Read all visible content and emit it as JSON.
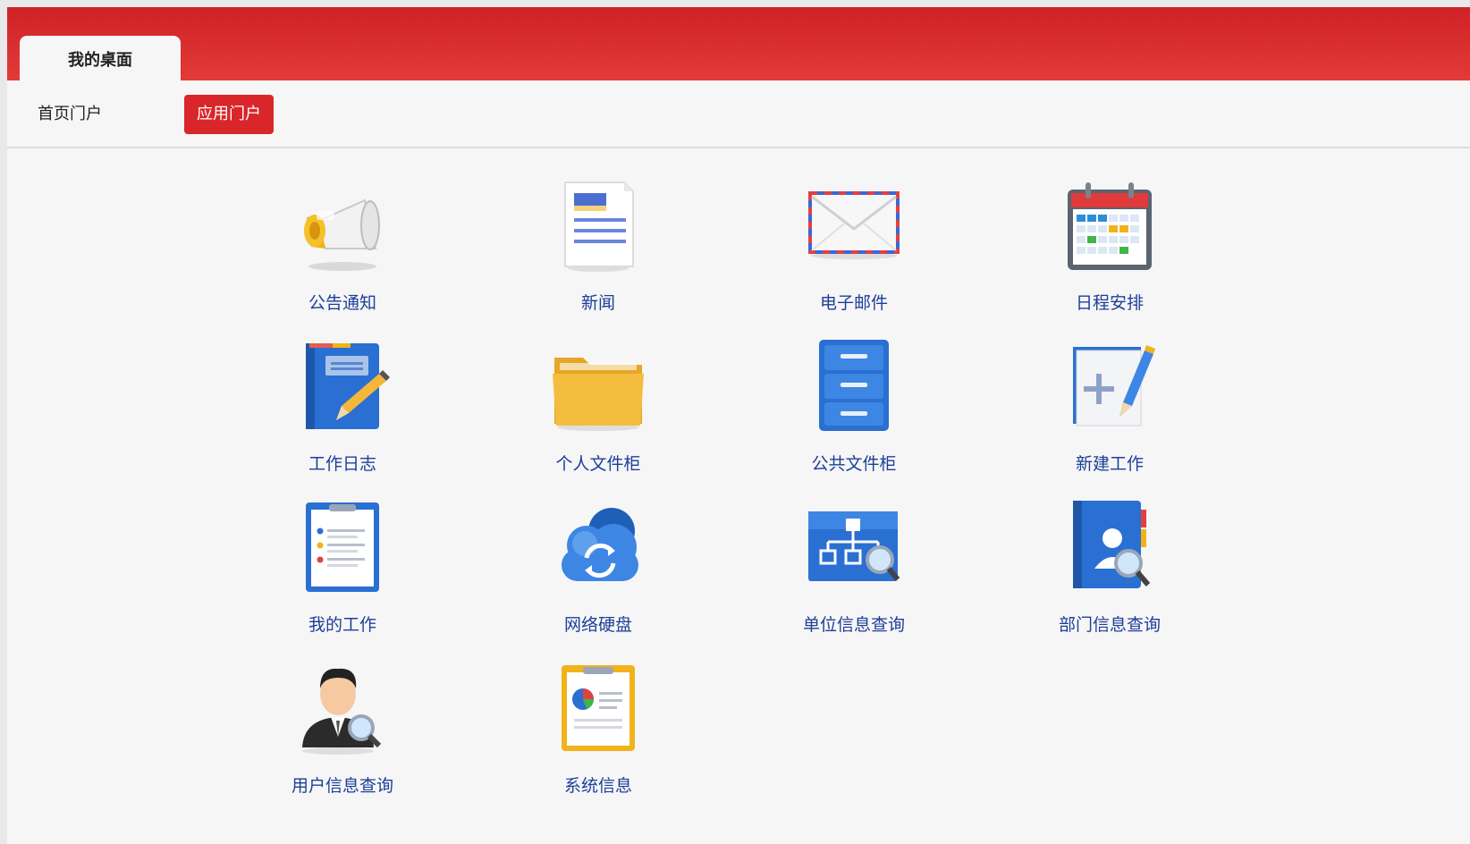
{
  "header": {
    "tab_label": "我的桌面"
  },
  "subnav": {
    "items": [
      {
        "label": "首页门户"
      },
      {
        "label": "应用门户"
      }
    ]
  },
  "colors": {
    "header_red": "#d9262a",
    "label_blue": "#1d3f9a"
  },
  "apps": [
    {
      "label": "公告通知",
      "icon": "megaphone-icon"
    },
    {
      "label": "新闻",
      "icon": "news-document-icon"
    },
    {
      "label": "电子邮件",
      "icon": "envelope-icon"
    },
    {
      "label": "日程安排",
      "icon": "calendar-icon"
    },
    {
      "label": "工作日志",
      "icon": "notebook-pencil-icon"
    },
    {
      "label": "个人文件柜",
      "icon": "folder-icon"
    },
    {
      "label": "公共文件柜",
      "icon": "filing-cabinet-icon"
    },
    {
      "label": "新建工作",
      "icon": "new-task-icon"
    },
    {
      "label": "我的工作",
      "icon": "clipboard-list-icon"
    },
    {
      "label": "网络硬盘",
      "icon": "cloud-sync-icon"
    },
    {
      "label": "单位信息查询",
      "icon": "org-chart-search-icon"
    },
    {
      "label": "部门信息查询",
      "icon": "contact-book-search-icon"
    },
    {
      "label": "用户信息查询",
      "icon": "user-search-icon"
    },
    {
      "label": "系统信息",
      "icon": "system-report-icon"
    }
  ]
}
